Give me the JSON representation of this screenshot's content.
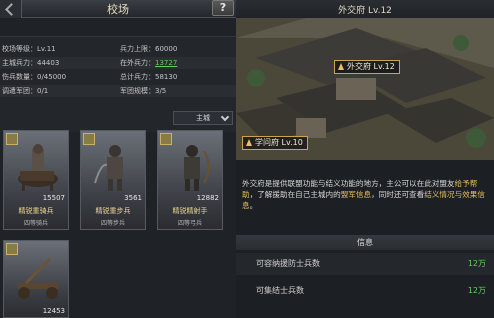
{
  "left": {
    "title": "校场",
    "help": "?",
    "stats": [
      {
        "l": "校场等级：Lv.11",
        "r": "兵力上限：60000"
      },
      {
        "l": "主城兵力：44403",
        "r": "在外兵力：",
        "rv": "13727"
      },
      {
        "l": "伤兵数量：0/45000",
        "r": "总计兵力：58130"
      },
      {
        "l": "调遣军团：0/1",
        "r": "军团规模：3/5"
      }
    ],
    "filter": "主城",
    "units": [
      {
        "count": "15507",
        "name": "精锐重骑兵",
        "sub": "四等骑兵"
      },
      {
        "count": "3561",
        "name": "精锐重步兵",
        "sub": "四等步兵"
      },
      {
        "count": "12882",
        "name": "精锐精射手",
        "sub": "四等弓兵"
      },
      {
        "count": "12453",
        "name": "",
        "sub": ""
      }
    ]
  },
  "right": {
    "header": "外交府 Lv.12",
    "scene_label_1": "外交府 Lv.12",
    "scene_label_2": "学问府 Lv.10",
    "desc_parts": [
      "外交府是提供联盟功能与结义功能的地方，主公可以在此对盟友",
      "给予帮助",
      "，了解援助在自己主城内的",
      "盟军信息",
      "，同时还可查看",
      "结义情况与效果信息",
      "。"
    ],
    "info_title": "信息",
    "info_rows": [
      {
        "k": "可容纳援防士兵数",
        "v": "12万"
      },
      {
        "k": "可集结士兵数",
        "v": "12万"
      }
    ]
  },
  "colors": {
    "accent": "#e8c060",
    "green": "#5fcf5f"
  }
}
